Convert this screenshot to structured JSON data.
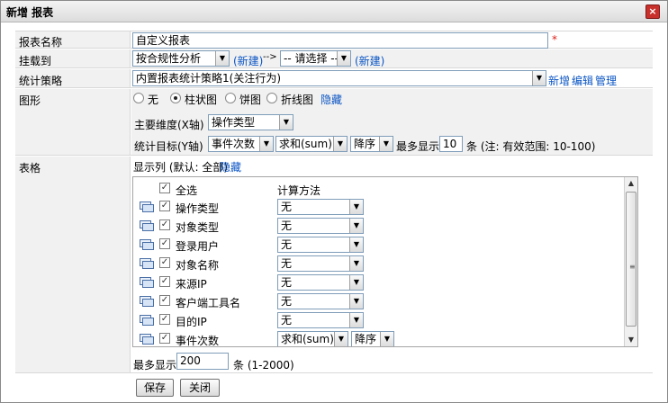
{
  "dialog": {
    "title": "新增 报表",
    "close_label": "×"
  },
  "form": {
    "name": {
      "label": "报表名称",
      "value": "自定义报表",
      "required_mark": "*"
    },
    "mount": {
      "label": "挂载到",
      "select1": "按合规性分析",
      "new1": "(新建)",
      "connector": "-->",
      "select2": "-- 请选择 --",
      "new2": "(新建)"
    },
    "strategy": {
      "label": "统计策略",
      "select": "内置报表统计策略1(关注行为)",
      "link_new": "新增",
      "link_edit": "编辑",
      "link_manage": "管理"
    },
    "chart": {
      "label": "图形",
      "options": [
        {
          "label": "无",
          "selected": false
        },
        {
          "label": "柱状图",
          "selected": true
        },
        {
          "label": "饼图",
          "selected": false
        },
        {
          "label": "折线图",
          "selected": false
        }
      ],
      "hide_link": "隐藏",
      "dimension_label": "主要维度(X轴)",
      "dimension_value": "操作类型",
      "target_label": "统计目标(Y轴)",
      "target_field": "事件次数",
      "target_func": "求和(sum)",
      "target_order": "降序",
      "max_label": "最多显示",
      "max_value": "10",
      "max_note": "条 (注: 有效范围: 10-100)"
    },
    "table": {
      "label": "表格",
      "columns_label": "显示列 (默认: 全部)",
      "hide_link": "隐藏",
      "select_all": "全选",
      "calc_header": "计算方法",
      "rows": [
        {
          "name": "操作类型",
          "method": "无"
        },
        {
          "name": "对象类型",
          "method": "无"
        },
        {
          "name": "登录用户",
          "method": "无"
        },
        {
          "name": "对象名称",
          "method": "无"
        },
        {
          "name": "来源IP",
          "method": "无"
        },
        {
          "name": "客户端工具名",
          "method": "无"
        },
        {
          "name": "目的IP",
          "method": "无"
        },
        {
          "name": "事件次数",
          "method": "求和(sum)",
          "order": "降序"
        }
      ],
      "max_label": "最多显示",
      "max_value": "200",
      "max_note": "条 (1-2000)"
    }
  },
  "buttons": {
    "save": "保存",
    "close": "关闭"
  }
}
